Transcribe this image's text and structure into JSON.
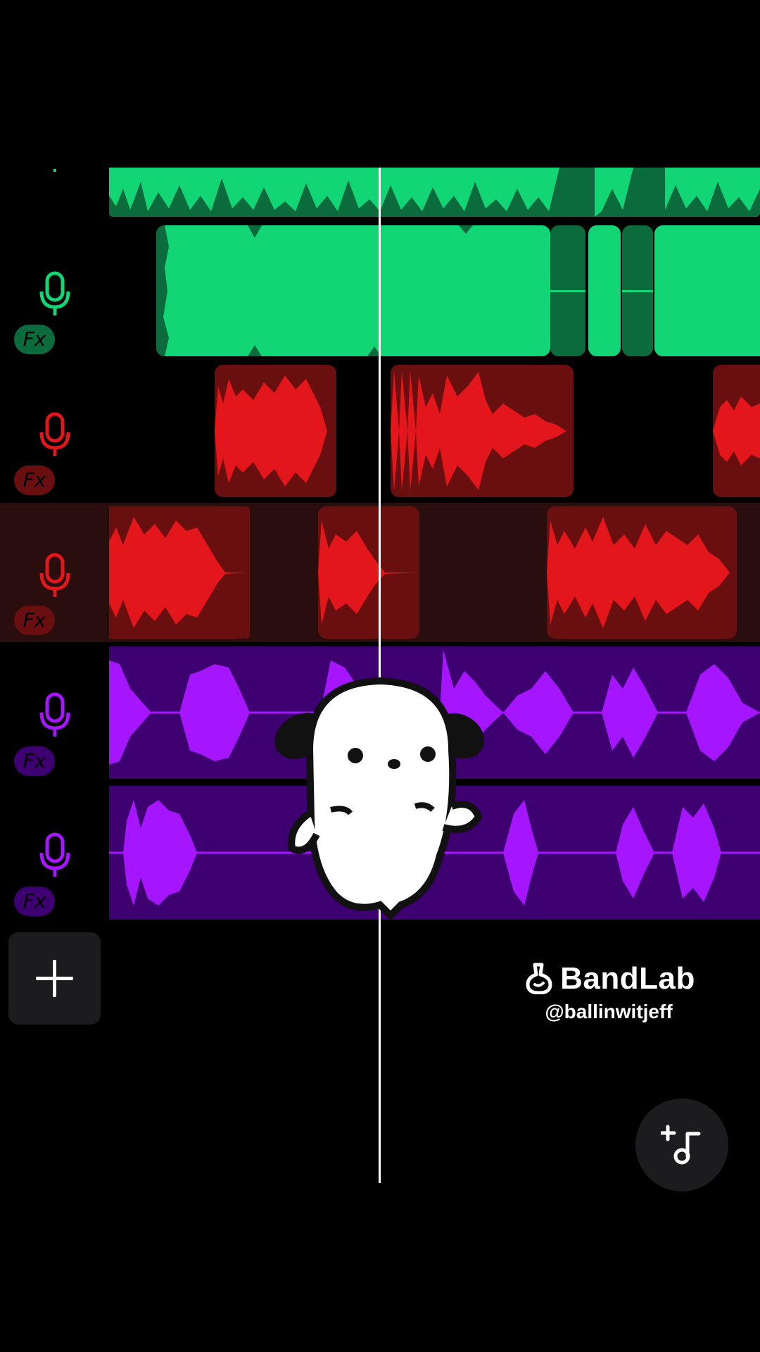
{
  "colors": {
    "green": "#12d675",
    "green_dark": "#0b6b3c",
    "red": "#e3161b",
    "red_clip_bg": "#6a0f0f",
    "purple": "#a516ff",
    "purple_clip_bg": "#3e0070",
    "panel": "#1c1c1e",
    "selected_track_bg": "#2a0d0d"
  },
  "tracks": [
    {
      "name": "track-green-top",
      "color": "green",
      "icons": []
    },
    {
      "name": "track-green",
      "color": "green",
      "icons": [
        "mic-icon",
        "fx-badge"
      ],
      "fx_label": "Fx"
    },
    {
      "name": "track-red-1",
      "color": "red",
      "icons": [
        "mic-icon",
        "fx-badge"
      ],
      "fx_label": "Fx"
    },
    {
      "name": "track-red-2",
      "color": "red",
      "selected": true,
      "icons": [
        "mic-icon",
        "fx-badge"
      ],
      "fx_label": "Fx"
    },
    {
      "name": "track-purple-1",
      "color": "purple",
      "icons": [
        "mic-icon",
        "fx-badge"
      ],
      "fx_label": "Fx"
    },
    {
      "name": "track-purple-2",
      "color": "purple",
      "icons": [
        "mic-icon",
        "fx-badge"
      ],
      "fx_label": "Fx"
    }
  ],
  "add_track": {
    "icon": "plus-icon"
  },
  "watermark": {
    "brand": "BandLab",
    "handle": "@ballinwitjeff",
    "icon": "bandlab-logo-icon"
  },
  "fab": {
    "icon": "add-music-note-icon"
  },
  "overlay": {
    "sticker": "dancing-puppy-sticker"
  }
}
